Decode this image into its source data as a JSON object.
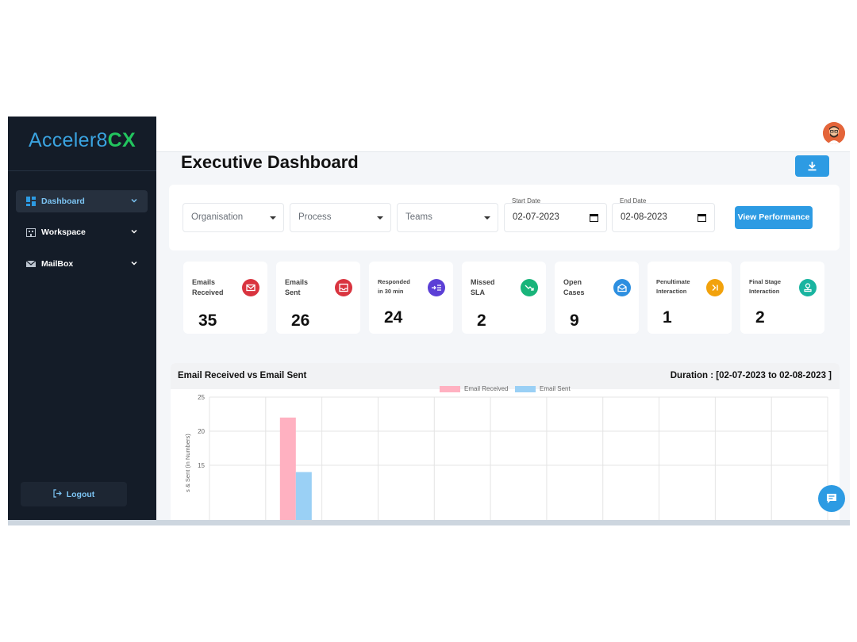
{
  "brand": {
    "part1": "Acceler8",
    "part2": "CX"
  },
  "sidebar": {
    "items": [
      {
        "label": "Dashboard",
        "icon": "dashboard-grid-icon",
        "active": true
      },
      {
        "label": "Workspace",
        "icon": "building-icon",
        "active": false
      },
      {
        "label": "MailBox",
        "icon": "mail-icon",
        "active": false
      }
    ],
    "logout_label": "Logout"
  },
  "header": {
    "title": "Executive Dashboard"
  },
  "filters": {
    "organisation": "Organisation",
    "process": "Process",
    "teams": "Teams",
    "start_date_label": "Start Date",
    "start_date": "02-07-2023",
    "end_date_label": "End Date",
    "end_date": "02-08-2023",
    "view_button": "View Performance"
  },
  "stats": [
    {
      "label1": "Emails",
      "label2": "Received",
      "value": "35",
      "color": "#d9343f",
      "icon": "mail-icon"
    },
    {
      "label1": "Emails",
      "label2": "Sent",
      "value": "26",
      "color": "#d9343f",
      "icon": "inbox-icon"
    },
    {
      "label1": "Responded",
      "label2": "in 30 min",
      "value": "24",
      "color": "#5b3fd6",
      "icon": "arrow-list-icon"
    },
    {
      "label1": "Missed",
      "label2": "SLA",
      "value": "2",
      "color": "#19b47a",
      "icon": "trend-down-icon"
    },
    {
      "label1": "Open",
      "label2": "Cases",
      "value": "9",
      "color": "#2d8fe0",
      "icon": "open-mail-icon"
    },
    {
      "label1": "Penultimate",
      "label2": "Interaction",
      "value": "1",
      "color": "#f2a20c",
      "icon": "skip-icon"
    },
    {
      "label1": "Final Stage",
      "label2": "Interaction",
      "value": "2",
      "color": "#19b4a0",
      "icon": "stamp-icon"
    }
  ],
  "chart_panel": {
    "title": "Email Received vs Email Sent",
    "duration": "Duration : [02-07-2023 to 02-08-2023 ]"
  },
  "chart_data": {
    "type": "bar",
    "series": [
      {
        "name": "Email Received",
        "color": "#ffb1c1",
        "values": [
          22
        ]
      },
      {
        "name": "Email Sent",
        "color": "#9ad0f5",
        "values": [
          14
        ]
      }
    ],
    "categories": [
      "",
      "",
      "",
      "",
      "",
      "",
      "",
      "",
      "",
      "",
      ""
    ],
    "bar_category_index": 1,
    "yticks": [
      "25",
      "20",
      "15"
    ],
    "ylim": [
      0,
      25
    ],
    "ylabel": "s & Sent (in Numbers)",
    "legend": "top",
    "grid": true
  }
}
